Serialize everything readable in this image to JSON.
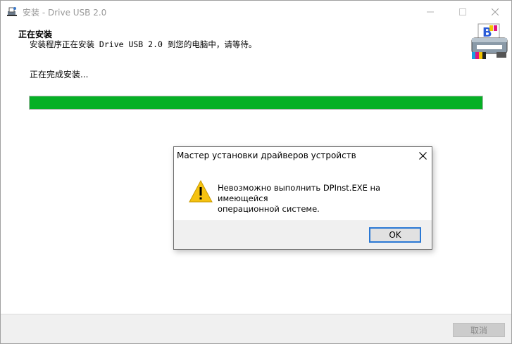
{
  "window": {
    "title": "安装 - Drive USB 2.0",
    "app_icon": "installer-icon"
  },
  "header": {
    "title": "正在安装",
    "subtitle": "安装程序正在安装 Drive USB 2.0 到您的电脑中，请等待。",
    "logo": "printer-logo"
  },
  "main": {
    "status": "正在完成安装...",
    "progress": 1.0,
    "progress_color": "#06b025"
  },
  "footer": {
    "cancel_label": "取消"
  },
  "dialog": {
    "title": "Мастер установки драйверов устройств",
    "message_line1": "Невозможно выполнить DPInst.EXE на имеющейся",
    "message_line2": "операционной системе.",
    "ok_label": "OK",
    "icon": "warning-icon",
    "accent": "#2a78d4"
  }
}
